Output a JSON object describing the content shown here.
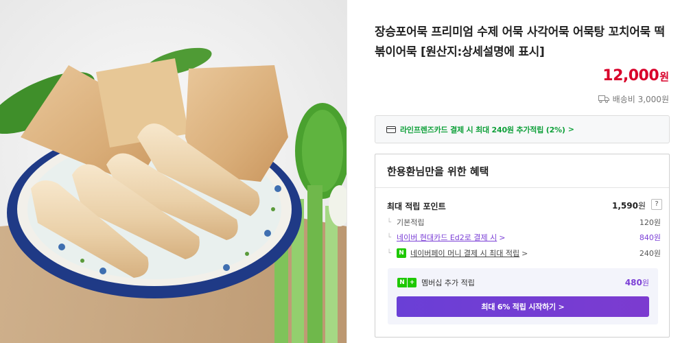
{
  "product": {
    "title": "장승포어묵 프리미엄 수제 어묵 사각어묵 어묵탕 꼬치어묵 떡볶이어묵 [원산지:상세설명에 표시]",
    "price": "12,000",
    "price_unit": "원",
    "shipping": "배송비 3,000원"
  },
  "card_promo": {
    "text": "라인프렌즈카드 결제 시 최대 240원 추가적립 (2%)",
    "chevron": ">"
  },
  "benefits": {
    "title": "한용환님만을 위한 혜택",
    "max_points_label": "최대 적립 포인트",
    "max_points_value": "1,590",
    "max_points_unit": "원",
    "help": "?",
    "rows": [
      {
        "label": "기본적립",
        "value": "120원"
      },
      {
        "label": "네이버 현대카드 Ed2로 결제 시",
        "value": "840원"
      },
      {
        "label": "네이버페이 머니 결제 시 최대 적립",
        "value": "240원"
      }
    ],
    "member": {
      "label": "멤버십 추가 적립",
      "value": "480",
      "unit": "원",
      "button": "최대 6% 적립 시작하기 >"
    }
  },
  "colors": {
    "price": "#d8002a",
    "promo_green": "#0fa03a",
    "accent_purple": "#7b3fd6",
    "naver_green": "#1ec800"
  }
}
